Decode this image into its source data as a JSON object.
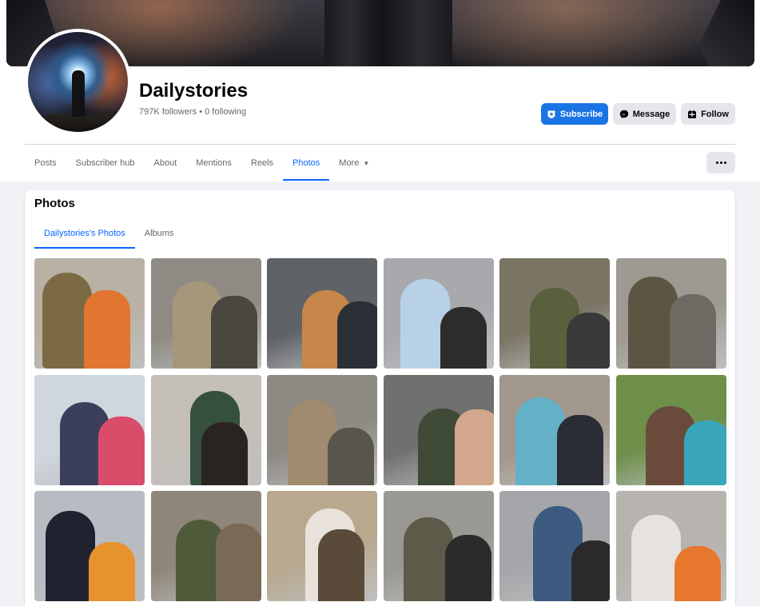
{
  "page": {
    "name": "Dailystories",
    "stats": "797K followers • 0 following"
  },
  "actions": {
    "subscribe": "Subscribe",
    "message": "Message",
    "follow": "Follow"
  },
  "tabs": [
    {
      "label": "Posts"
    },
    {
      "label": "Subscriber hub"
    },
    {
      "label": "About"
    },
    {
      "label": "Mentions"
    },
    {
      "label": "Reels"
    },
    {
      "label": "Photos",
      "active": true
    },
    {
      "label": "More"
    }
  ],
  "photos_section": {
    "title": "Photos",
    "subtabs": [
      {
        "label": "Dailystories's Photos",
        "active": true
      },
      {
        "label": "Albums"
      }
    ],
    "items": [
      {
        "bg": "#b9b1a4",
        "c1": "#7b6a44",
        "c2": "#e2752f"
      },
      {
        "bg": "#8f8b84",
        "c1": "#a7977a",
        "c2": "#4a4740"
      },
      {
        "bg": "#5f6266",
        "c1": "#c7874a",
        "c2": "#2b3036"
      },
      {
        "bg": "#a7a9ad",
        "c1": "#b9d1e6",
        "c2": "#2d2b2b"
      },
      {
        "bg": "#7b7566",
        "c1": "#59603d",
        "c2": "#3a3a3a"
      },
      {
        "bg": "#9e9a92",
        "c1": "#5d5543",
        "c2": "#6e6a63"
      },
      {
        "bg": "#cfd6de",
        "c1": "#3b3f5c",
        "c2": "#d94c6a"
      },
      {
        "bg": "#c4bfb8",
        "c1": "#35503f",
        "c2": "#2a2420"
      },
      {
        "bg": "#8d8a84",
        "c1": "#a08b70",
        "c2": "#5a554c"
      },
      {
        "bg": "#6f7070",
        "c1": "#3f4a37",
        "c2": "#d2a78b"
      },
      {
        "bg": "#a2978c",
        "c1": "#63b0c7",
        "c2": "#2a2d36"
      },
      {
        "bg": "#6d8f4a",
        "c1": "#6a4b3b",
        "c2": "#3aa6b9"
      },
      {
        "bg": "#b7bcc2",
        "c1": "#1f2330",
        "c2": "#e8922e"
      },
      {
        "bg": "#8e8678",
        "c1": "#4e5a3a",
        "c2": "#7a6a55"
      },
      {
        "bg": "#b8a88e",
        "c1": "#e8e2da",
        "c2": "#5a4a3a"
      },
      {
        "bg": "#9a9892",
        "c1": "#5c5a48",
        "c2": "#2b2b2b"
      },
      {
        "bg": "#a4a6a9",
        "c1": "#3d5a80",
        "c2": "#2a2a2a"
      },
      {
        "bg": "#b7b3ae",
        "c1": "#e6e2de",
        "c2": "#e8772e"
      }
    ]
  }
}
